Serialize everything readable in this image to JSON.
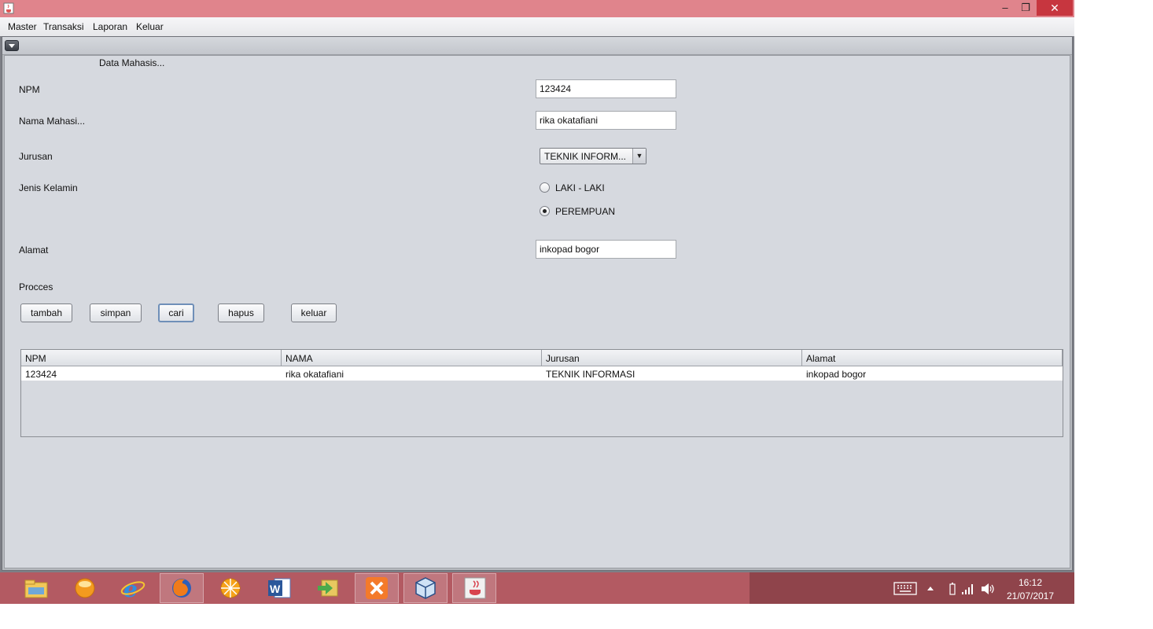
{
  "window": {
    "minimize": "–",
    "maximize": "❐",
    "close": "✕"
  },
  "menu": [
    "Master",
    "Transaksi",
    "Laporan",
    "Keluar"
  ],
  "frame_title": "Data Mahasis...",
  "form": {
    "npm": {
      "label": "NPM",
      "value": "123424"
    },
    "nama": {
      "label": "Nama Mahasi...",
      "value": "rika okatafiani"
    },
    "jurusan": {
      "label": "Jurusan",
      "value": "TEKNIK INFORM..."
    },
    "jenis_kelamin": {
      "label": "Jenis Kelamin",
      "options": [
        "LAKI -  LAKI",
        "PEREMPUAN"
      ],
      "selected": "PEREMPUAN"
    },
    "alamat": {
      "label": "Alamat",
      "value": "inkopad bogor"
    },
    "process_label": "Procces"
  },
  "buttons": {
    "tambah": "tambah",
    "simpan": "simpan",
    "cari": "cari",
    "hapus": "hapus",
    "keluar": "keluar"
  },
  "table": {
    "headers": [
      "NPM",
      "NAMA",
      "Jurusan",
      "Alamat"
    ],
    "rows": [
      [
        "123424",
        "rika okatafiani",
        "TEKNIK INFORMASI",
        "inkopad bogor"
      ]
    ]
  },
  "taskbar": {
    "apps": [
      "file-explorer-icon",
      "media-player-icon",
      "internet-explorer-icon",
      "firefox-icon",
      "app-orange-icon",
      "word-icon",
      "app-arrow-icon",
      "xampp-icon",
      "virtualbox-icon",
      "java-icon"
    ],
    "time": "16:12",
    "date": "21/07/2017"
  }
}
